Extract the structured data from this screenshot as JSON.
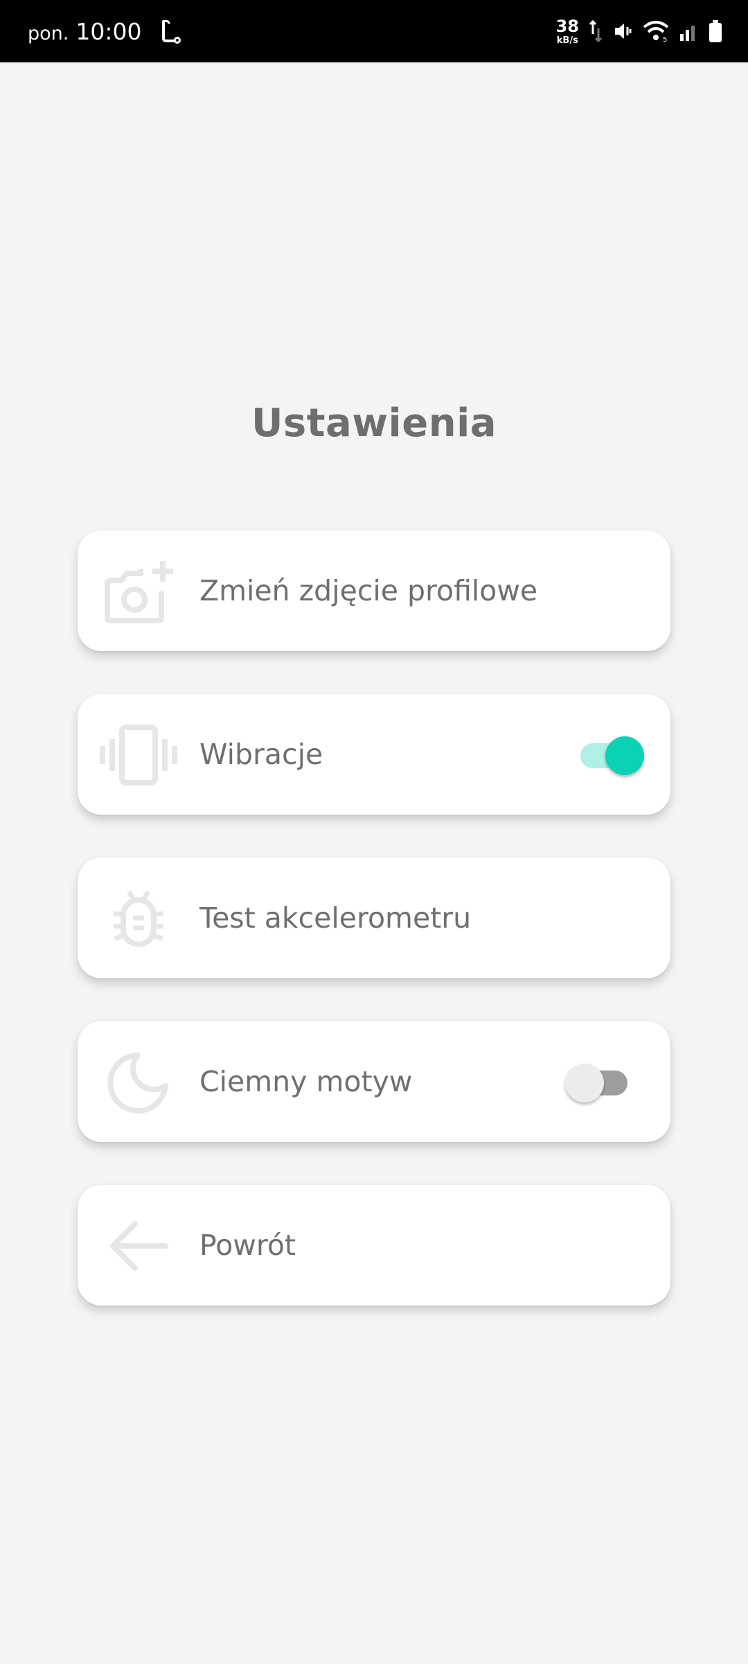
{
  "status_bar": {
    "day": "pon.",
    "time": "10:00",
    "net_speed_value": "38",
    "net_speed_unit": "kB/s",
    "icons": [
      "app-notification-icon",
      "data-transfer-icon",
      "vibrate-mode-icon",
      "wifi-icon",
      "cell-signal-icon",
      "battery-icon"
    ]
  },
  "page": {
    "title": "Ustawienia"
  },
  "settings": {
    "items": [
      {
        "label": "Zmień zdjęcie profilowe",
        "icon": "add-photo-icon"
      },
      {
        "label": "Wibracje",
        "icon": "vibration-icon",
        "toggle": true
      },
      {
        "label": "Test akcelerometru",
        "icon": "bug-icon"
      },
      {
        "label": "Ciemny motyw",
        "icon": "moon-icon",
        "toggle": false
      },
      {
        "label": "Powrót",
        "icon": "arrow-left-icon"
      }
    ]
  },
  "colors": {
    "background": "#f4f4f4",
    "card": "#ffffff",
    "text": "#6f6f6f",
    "icon": "#e6e6e9",
    "accent": "#0bd1b5",
    "accent_track": "#aef0e3"
  }
}
